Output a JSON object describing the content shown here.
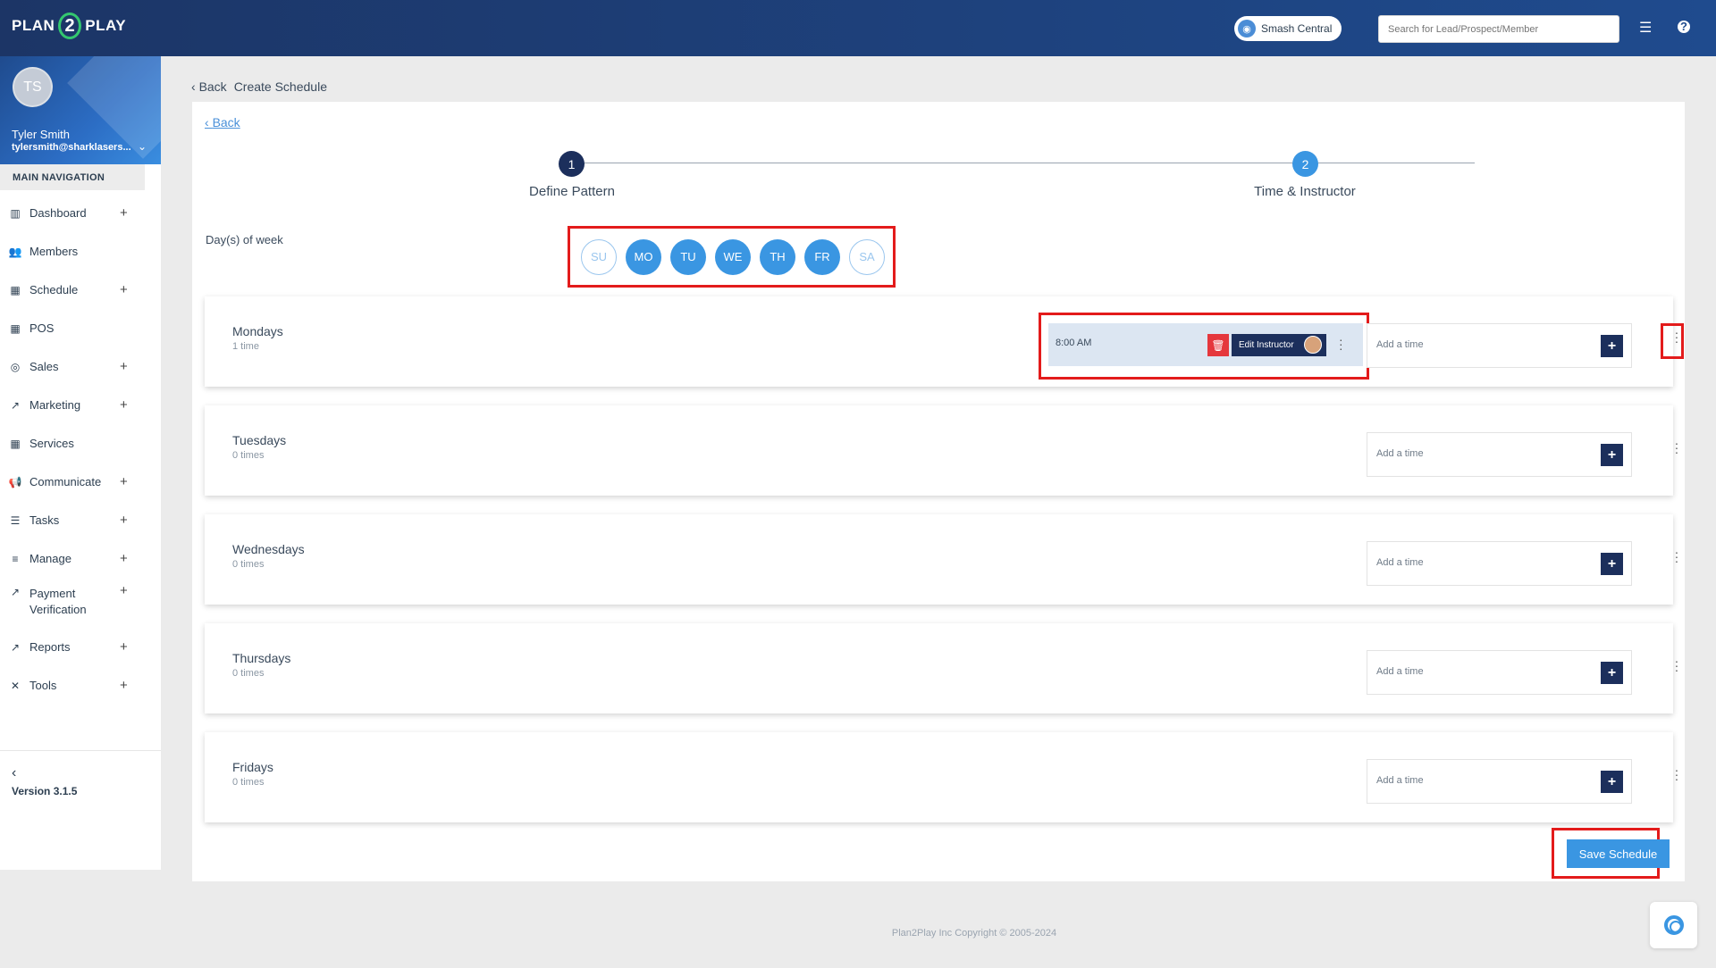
{
  "header": {
    "logo_left": "PLAN",
    "logo_mid": "2",
    "logo_right": "PLAY",
    "location": "Smash Central",
    "search_placeholder": "Search for Lead/Prospect/Member"
  },
  "user": {
    "initials": "TS",
    "name": "Tyler Smith",
    "email": "tylersmith@sharklasers..."
  },
  "sidebar": {
    "heading": "MAIN NAVIGATION",
    "items": [
      {
        "label": "Dashboard",
        "icon": "bar-chart-icon",
        "expandable": true
      },
      {
        "label": "Members",
        "icon": "users-icon",
        "expandable": false
      },
      {
        "label": "Schedule",
        "icon": "calendar-icon",
        "expandable": true
      },
      {
        "label": "POS",
        "icon": "grid-icon",
        "expandable": false
      },
      {
        "label": "Sales",
        "icon": "target-icon",
        "expandable": true
      },
      {
        "label": "Marketing",
        "icon": "line-chart-icon",
        "expandable": true
      },
      {
        "label": "Services",
        "icon": "grid-icon",
        "expandable": false
      },
      {
        "label": "Communicate",
        "icon": "megaphone-icon",
        "expandable": true
      },
      {
        "label": "Tasks",
        "icon": "list-icon",
        "expandable": true
      },
      {
        "label": "Manage",
        "icon": "menu-icon",
        "expandable": true
      },
      {
        "label": "Payment Verification",
        "icon": "line-chart-icon",
        "expandable": true
      },
      {
        "label": "Reports",
        "icon": "line-chart-icon",
        "expandable": true
      },
      {
        "label": "Tools",
        "icon": "tools-icon",
        "expandable": true
      }
    ],
    "version": "Version 3.1.5"
  },
  "breadcrumb": {
    "back": "Back",
    "title": "Create Schedule"
  },
  "panel": {
    "back_link": "Back",
    "steps": [
      {
        "number": "1",
        "label": "Define Pattern",
        "active": true
      },
      {
        "number": "2",
        "label": "Time & Instructor",
        "active": false
      }
    ],
    "dow_label": "Day(s) of week",
    "days": [
      {
        "code": "SU",
        "selected": false
      },
      {
        "code": "MO",
        "selected": true
      },
      {
        "code": "TU",
        "selected": true
      },
      {
        "code": "WE",
        "selected": true
      },
      {
        "code": "TH",
        "selected": true
      },
      {
        "code": "FR",
        "selected": true
      },
      {
        "code": "SA",
        "selected": false
      }
    ],
    "rows": [
      {
        "name": "Mondays",
        "count": "1 time"
      },
      {
        "name": "Tuesdays",
        "count": "0 times"
      },
      {
        "name": "Wednesdays",
        "count": "0 times"
      },
      {
        "name": "Thursdays",
        "count": "0 times"
      },
      {
        "name": "Fridays",
        "count": "0 times"
      }
    ],
    "monday_slot": {
      "time": "8:00 AM",
      "edit_label": "Edit Instructor"
    },
    "add_time_placeholder": "Add a time",
    "save_label": "Save Schedule"
  },
  "footer": {
    "copyright": "Plan2Play Inc Copyright © 2005-2024"
  },
  "colors": {
    "accent": "#3a96e2",
    "navy": "#1c2f5c",
    "highlight": "#e31b1b",
    "danger": "#e5373d"
  }
}
